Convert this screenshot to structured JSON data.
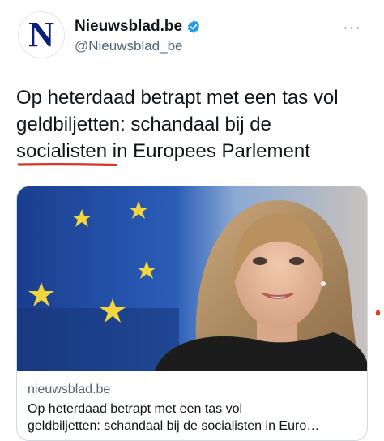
{
  "account": {
    "display_name": "Nieuwsblad.be",
    "handle": "@Nieuwsblad_be",
    "avatar_letter": "N",
    "verified": true,
    "more_label": "···"
  },
  "tweet": {
    "line1": "Op heterdaad betrapt met een tas vol",
    "line2": "geldbiljetten: schandaal bij de",
    "highlight_word": "socialisten",
    "line3_rest": " in Europees Parlement"
  },
  "card": {
    "domain": "nieuwsblad.be",
    "title_line1": "Op heterdaad betrapt met een tas vol",
    "title_line2": "geldbiljetten: schandaal bij de socialisten in Euro…"
  },
  "colors": {
    "brand_blue": "#0b1f7a",
    "verified_blue": "#1d9bf0",
    "underline_red": "#d9342b",
    "eu_blue": "#1f4fa8",
    "eu_star_yellow": "#f2d53c"
  }
}
